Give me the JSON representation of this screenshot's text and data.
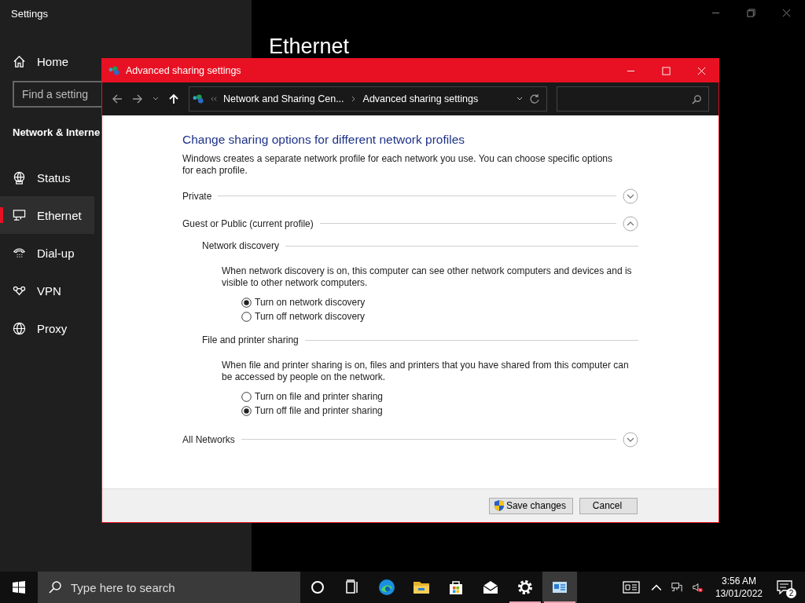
{
  "settings_window": {
    "title": "Settings",
    "home": "Home",
    "search": {
      "placeholder": "Find a setting"
    },
    "section": "Network & Interne",
    "items": [
      {
        "label": "Status",
        "kind": "status",
        "selected": false
      },
      {
        "label": "Ethernet",
        "kind": "ethernet",
        "selected": true
      },
      {
        "label": "Dial-up",
        "kind": "dialup",
        "selected": false
      },
      {
        "label": "VPN",
        "kind": "vpn",
        "selected": false
      },
      {
        "label": "Proxy",
        "kind": "proxy",
        "selected": false
      }
    ],
    "page_title": "Ethernet"
  },
  "dialog": {
    "title": "Advanced sharing settings",
    "breadcrumb": [
      "Network and Sharing Cen...",
      "Advanced sharing settings"
    ],
    "heading": "Change sharing options for different network profiles",
    "intro": "Windows creates a separate network profile for each network you use. You can choose specific options for each profile.",
    "profiles": [
      {
        "name": "Private",
        "expanded": false
      },
      {
        "name": "Guest or Public (current profile)",
        "expanded": true,
        "groups": [
          {
            "title": "Network discovery",
            "description": "When network discovery is on, this computer can see other network computers and devices and is visible to other network computers.",
            "options": [
              {
                "label": "Turn on network discovery",
                "selected": true
              },
              {
                "label": "Turn off network discovery",
                "selected": false
              }
            ]
          },
          {
            "title": "File and printer sharing",
            "description": "When file and printer sharing is on, files and printers that you have shared from this computer can be accessed by people on the network.",
            "options": [
              {
                "label": "Turn on file and printer sharing",
                "selected": false
              },
              {
                "label": "Turn off file and printer sharing",
                "selected": true
              }
            ]
          }
        ]
      },
      {
        "name": "All Networks",
        "expanded": false
      }
    ],
    "buttons": [
      {
        "label": "Save changes",
        "kind": "shield"
      },
      {
        "label": "Cancel",
        "kind": "plain"
      }
    ]
  },
  "taskbar": {
    "search_placeholder": "Type here to search",
    "apps": [
      {
        "kind": "cortana",
        "running": false,
        "active": false
      },
      {
        "kind": "taskview",
        "running": false,
        "active": false
      },
      {
        "kind": "edge",
        "running": false,
        "active": false
      },
      {
        "kind": "explorer",
        "running": false,
        "active": false
      },
      {
        "kind": "store",
        "running": false,
        "active": false
      },
      {
        "kind": "mail",
        "running": false,
        "active": false
      },
      {
        "kind": "settings",
        "running": true,
        "active": false
      },
      {
        "kind": "controlpanel",
        "running": true,
        "active": true
      }
    ],
    "time": "3:56 AM",
    "date": "13/01/2022",
    "notification_count": "2"
  }
}
